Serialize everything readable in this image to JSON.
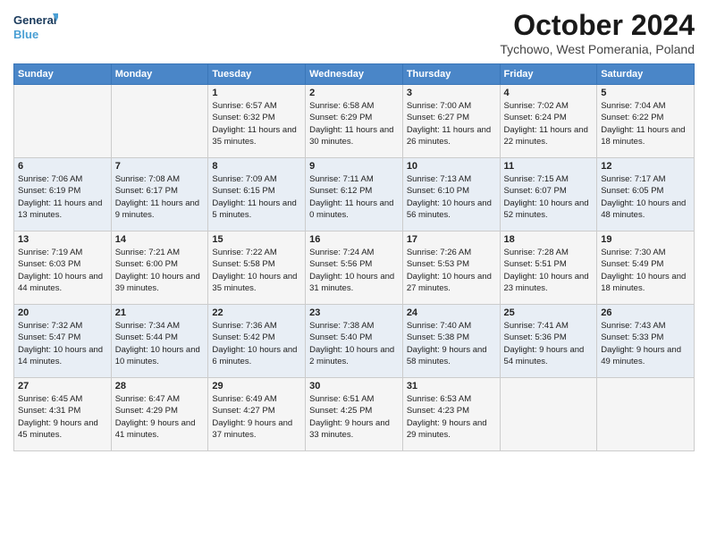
{
  "logo": {
    "line1": "General",
    "line2": "Blue"
  },
  "title": "October 2024",
  "subtitle": "Tychowo, West Pomerania, Poland",
  "headers": [
    "Sunday",
    "Monday",
    "Tuesday",
    "Wednesday",
    "Thursday",
    "Friday",
    "Saturday"
  ],
  "weeks": [
    [
      {
        "day": "",
        "content": ""
      },
      {
        "day": "",
        "content": ""
      },
      {
        "day": "1",
        "content": "Sunrise: 6:57 AM\nSunset: 6:32 PM\nDaylight: 11 hours and 35 minutes."
      },
      {
        "day": "2",
        "content": "Sunrise: 6:58 AM\nSunset: 6:29 PM\nDaylight: 11 hours and 30 minutes."
      },
      {
        "day": "3",
        "content": "Sunrise: 7:00 AM\nSunset: 6:27 PM\nDaylight: 11 hours and 26 minutes."
      },
      {
        "day": "4",
        "content": "Sunrise: 7:02 AM\nSunset: 6:24 PM\nDaylight: 11 hours and 22 minutes."
      },
      {
        "day": "5",
        "content": "Sunrise: 7:04 AM\nSunset: 6:22 PM\nDaylight: 11 hours and 18 minutes."
      }
    ],
    [
      {
        "day": "6",
        "content": "Sunrise: 7:06 AM\nSunset: 6:19 PM\nDaylight: 11 hours and 13 minutes."
      },
      {
        "day": "7",
        "content": "Sunrise: 7:08 AM\nSunset: 6:17 PM\nDaylight: 11 hours and 9 minutes."
      },
      {
        "day": "8",
        "content": "Sunrise: 7:09 AM\nSunset: 6:15 PM\nDaylight: 11 hours and 5 minutes."
      },
      {
        "day": "9",
        "content": "Sunrise: 7:11 AM\nSunset: 6:12 PM\nDaylight: 11 hours and 0 minutes."
      },
      {
        "day": "10",
        "content": "Sunrise: 7:13 AM\nSunset: 6:10 PM\nDaylight: 10 hours and 56 minutes."
      },
      {
        "day": "11",
        "content": "Sunrise: 7:15 AM\nSunset: 6:07 PM\nDaylight: 10 hours and 52 minutes."
      },
      {
        "day": "12",
        "content": "Sunrise: 7:17 AM\nSunset: 6:05 PM\nDaylight: 10 hours and 48 minutes."
      }
    ],
    [
      {
        "day": "13",
        "content": "Sunrise: 7:19 AM\nSunset: 6:03 PM\nDaylight: 10 hours and 44 minutes."
      },
      {
        "day": "14",
        "content": "Sunrise: 7:21 AM\nSunset: 6:00 PM\nDaylight: 10 hours and 39 minutes."
      },
      {
        "day": "15",
        "content": "Sunrise: 7:22 AM\nSunset: 5:58 PM\nDaylight: 10 hours and 35 minutes."
      },
      {
        "day": "16",
        "content": "Sunrise: 7:24 AM\nSunset: 5:56 PM\nDaylight: 10 hours and 31 minutes."
      },
      {
        "day": "17",
        "content": "Sunrise: 7:26 AM\nSunset: 5:53 PM\nDaylight: 10 hours and 27 minutes."
      },
      {
        "day": "18",
        "content": "Sunrise: 7:28 AM\nSunset: 5:51 PM\nDaylight: 10 hours and 23 minutes."
      },
      {
        "day": "19",
        "content": "Sunrise: 7:30 AM\nSunset: 5:49 PM\nDaylight: 10 hours and 18 minutes."
      }
    ],
    [
      {
        "day": "20",
        "content": "Sunrise: 7:32 AM\nSunset: 5:47 PM\nDaylight: 10 hours and 14 minutes."
      },
      {
        "day": "21",
        "content": "Sunrise: 7:34 AM\nSunset: 5:44 PM\nDaylight: 10 hours and 10 minutes."
      },
      {
        "day": "22",
        "content": "Sunrise: 7:36 AM\nSunset: 5:42 PM\nDaylight: 10 hours and 6 minutes."
      },
      {
        "day": "23",
        "content": "Sunrise: 7:38 AM\nSunset: 5:40 PM\nDaylight: 10 hours and 2 minutes."
      },
      {
        "day": "24",
        "content": "Sunrise: 7:40 AM\nSunset: 5:38 PM\nDaylight: 9 hours and 58 minutes."
      },
      {
        "day": "25",
        "content": "Sunrise: 7:41 AM\nSunset: 5:36 PM\nDaylight: 9 hours and 54 minutes."
      },
      {
        "day": "26",
        "content": "Sunrise: 7:43 AM\nSunset: 5:33 PM\nDaylight: 9 hours and 49 minutes."
      }
    ],
    [
      {
        "day": "27",
        "content": "Sunrise: 6:45 AM\nSunset: 4:31 PM\nDaylight: 9 hours and 45 minutes."
      },
      {
        "day": "28",
        "content": "Sunrise: 6:47 AM\nSunset: 4:29 PM\nDaylight: 9 hours and 41 minutes."
      },
      {
        "day": "29",
        "content": "Sunrise: 6:49 AM\nSunset: 4:27 PM\nDaylight: 9 hours and 37 minutes."
      },
      {
        "day": "30",
        "content": "Sunrise: 6:51 AM\nSunset: 4:25 PM\nDaylight: 9 hours and 33 minutes."
      },
      {
        "day": "31",
        "content": "Sunrise: 6:53 AM\nSunset: 4:23 PM\nDaylight: 9 hours and 29 minutes."
      },
      {
        "day": "",
        "content": ""
      },
      {
        "day": "",
        "content": ""
      }
    ]
  ]
}
